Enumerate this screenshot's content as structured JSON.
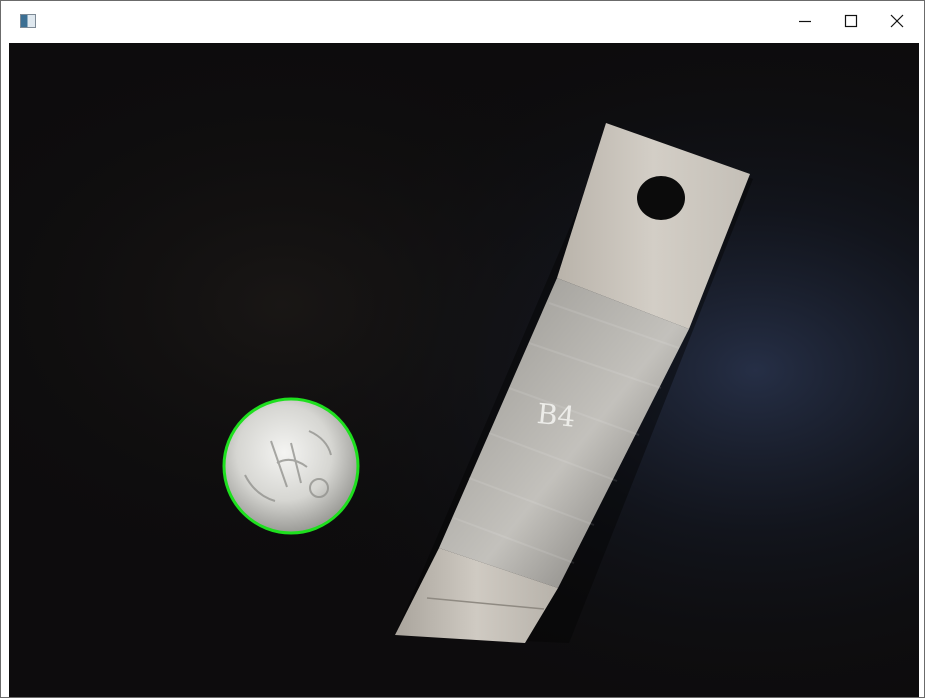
{
  "window": {
    "title": "",
    "icon": "opencv-image-window-icon",
    "controls": {
      "minimize": "minimize-icon",
      "maximize": "maximize-icon",
      "close": "close-icon"
    }
  },
  "image": {
    "engraved_label": "B4",
    "coin_outline_color": "#1ee01e",
    "background_color": "#0d0c0d",
    "metal_color": "#c9c4bc"
  }
}
